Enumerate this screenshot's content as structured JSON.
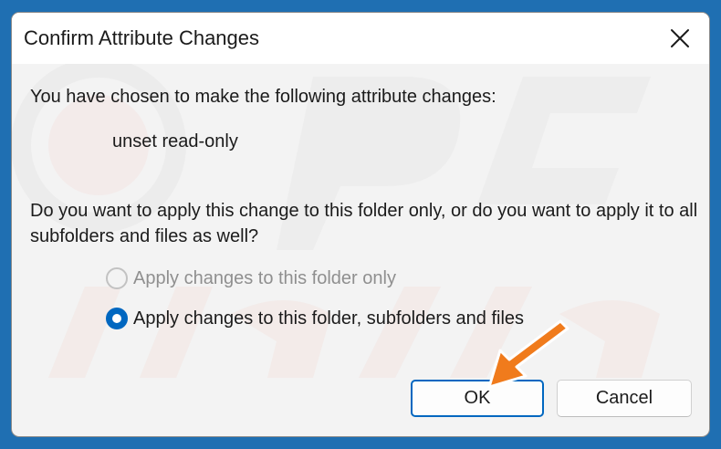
{
  "dialog": {
    "title": "Confirm Attribute Changes",
    "intro": "You have chosen to make the following attribute changes:",
    "change": "unset read-only",
    "question": "Do you want to apply this change to this folder only, or do you want to apply it to all subfolders and files as well?",
    "options": [
      {
        "label": "Apply changes to this folder only",
        "selected": false,
        "disabled": true
      },
      {
        "label": "Apply changes to this folder, subfolders and files",
        "selected": true,
        "disabled": false
      }
    ],
    "buttons": {
      "ok": "OK",
      "cancel": "Cancel"
    }
  },
  "colors": {
    "accent": "#0067c0",
    "annotation_arrow": "#f07b1c",
    "desktop": "#1f6fb2"
  },
  "icons": {
    "close": "close-icon",
    "arrow": "arrow-annotation-icon"
  }
}
